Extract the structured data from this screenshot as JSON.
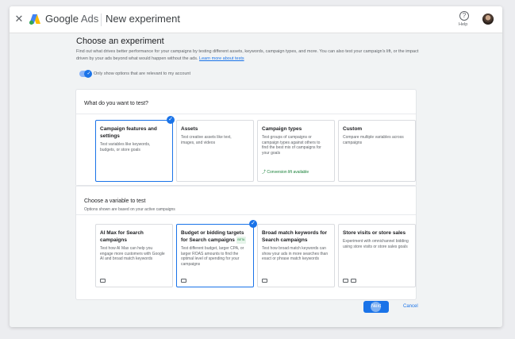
{
  "topbar": {
    "close_glyph": "✕",
    "brand_google": "Google",
    "brand_ads": "Ads",
    "page_title": "New experiment",
    "help_glyph": "?",
    "help_label": "Help"
  },
  "main": {
    "heading": "Choose an experiment",
    "intro_text": "Find out what drives better performance for your campaigns by testing different assets, keywords, campaign types, and more. You can also test your campaign's lift, or the impact driven by your ads beyond what would happen without the ads.",
    "intro_link": "Learn more about tests",
    "toggle_label": "Only show options that are relevant to my account",
    "toggle_on": true
  },
  "test_section": {
    "title": "What do you want to test?",
    "cards": [
      {
        "title": "Campaign features and settings",
        "desc": "Test variables like keywords, budgets, or store goals",
        "selected": true
      },
      {
        "title": "Assets",
        "desc": "Test creative assets like text, images, and videos",
        "selected": false
      },
      {
        "title": "Campaign types",
        "desc": "Test groups of campaigns or campaign types against others to find the best mix of campaigns for your goals",
        "extra": "Conversion lift available",
        "selected": false
      },
      {
        "title": "Custom",
        "desc": "Compare multiple variables across campaigns",
        "selected": false
      }
    ]
  },
  "variable_section": {
    "title": "Choose a variable to test",
    "subtitle": "Options shown are based on your active campaigns",
    "cards": [
      {
        "title": "AI Max for Search campaigns",
        "desc": "Test how AI Max can help you engage more customers with Google AI and broad match keywords",
        "selected": false
      },
      {
        "title": "Budget or bidding targets for Search campaigns",
        "badge": "BETA",
        "desc": "Test different budget, larger CPA, or larger ROAS amounts to find the optimal level of spending for your campaigns",
        "selected": true
      },
      {
        "title": "Broad match keywords for Search campaigns",
        "desc": "Test how broad match keywords can show your ads in more searches than exact or phrase match keywords",
        "selected": false
      },
      {
        "title": "Store visits or store sales",
        "desc": "Experiment with omnichannel bidding using store visits or store sales goals",
        "selected": false
      }
    ]
  },
  "footer": {
    "next_label": "Next",
    "cancel_label": "Cancel"
  },
  "colors": {
    "accent": "#1a73e8",
    "success": "#188038",
    "background": "#f1f3f4"
  }
}
